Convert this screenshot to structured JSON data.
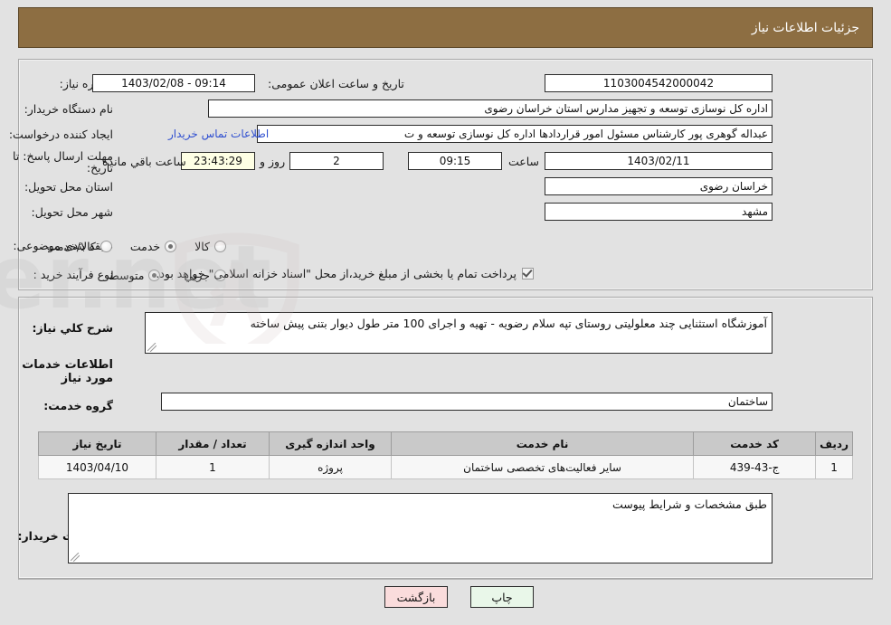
{
  "header": {
    "title": "جزئیات اطلاعات نیاز"
  },
  "top_form": {
    "need_number": {
      "label": "شماره نیاز:",
      "value": "1103004542000042"
    },
    "public_announce": {
      "label": "تاریخ و ساعت اعلان عمومی:",
      "value": "1403/02/08 - 09:14"
    },
    "buyer_org": {
      "label": "نام دستگاه خریدار:",
      "value": "اداره کل نوسازی  توسعه و تجهیز مدارس استان خراسان رضوی"
    },
    "creator": {
      "label": "ایجاد کننده درخواست:",
      "value": "عبداله گوهری پور کارشناس مسئول امور قراردادها  اداره کل نوسازی  توسعه و ت"
    },
    "contact_link": "اطلاعات تماس خریدار",
    "deadline": {
      "label": "مهلت ارسال پاسخ: تا تاریخ:",
      "date": "1403/02/11",
      "time_label": "ساعت",
      "time": "09:15",
      "days": "2",
      "days_suffix": "روز و",
      "countdown": "23:43:29",
      "countdown_suffix": "ساعت باقي مانده"
    },
    "province": {
      "label": "استان محل تحویل:",
      "value": "خراسان رضوی"
    },
    "city": {
      "label": "شهر محل تحویل:",
      "value": "مشهد"
    },
    "category": {
      "label": "طبقه بندی موضوعی:",
      "options": [
        "کالا",
        "خدمت",
        "کالا/خدمت"
      ],
      "selected": "خدمت"
    },
    "purchase_type": {
      "label": "نوع فرآیند خرید :",
      "options": [
        "جزیي",
        "متوسط"
      ],
      "selected": "متوسط",
      "checkbox_label": "پرداخت تمام یا بخشی از مبلغ خرید،از محل \"اسناد خزانه اسلامی\" خواهد بود.",
      "checkbox_checked": true
    }
  },
  "description": {
    "label": "شرح كلي نياز:",
    "value": "آموزشگاه استثنایی چند معلولیتی روستای تپه سلام رضویه - تهیه و اجرای 100 متر طول دیوار بتنی پیش ساخته"
  },
  "services_section": {
    "title": "اطلاعات خدمات مورد نیاز",
    "service_group": {
      "label": "گروه خدمت:",
      "value": "ساختمان"
    },
    "table": {
      "columns": [
        "ردیف",
        "کد خدمت",
        "نام خدمت",
        "واحد اندازه گیری",
        "تعداد / مقدار",
        "تاریخ نیاز"
      ],
      "rows": [
        {
          "index": "1",
          "code": "ج-43-439",
          "name": "سایر فعالیت‌های تخصصی ساختمان",
          "unit": "پروژه",
          "quantity": "1",
          "need_date": "1403/04/10"
        }
      ]
    }
  },
  "buyer_notes": {
    "label": "توضیحات خریدار:",
    "value": "طبق مشخصات و شرایط پیوست"
  },
  "buttons": {
    "print": "چاپ",
    "back": "بازگشت"
  },
  "colors": {
    "header_bar": "#8d6e42",
    "page_bg": "#e2e2e2",
    "link": "#2f4fd0",
    "countdown_bg": "#feffe4",
    "table_header_bg": "#c9c9c9",
    "print_btn_bg": "#e9f7e9",
    "back_btn_bg": "#fadcdc"
  },
  "watermark": {
    "text": "AnaTender.net"
  }
}
